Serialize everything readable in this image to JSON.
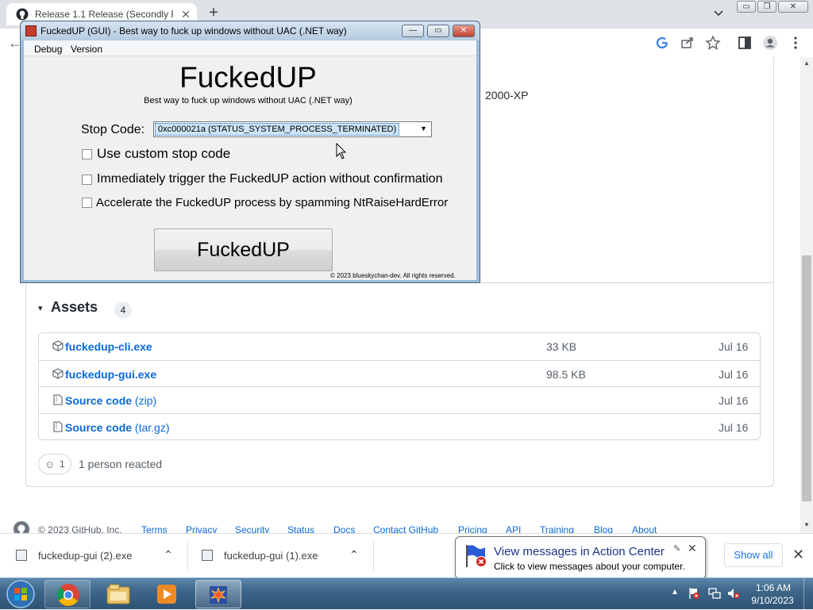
{
  "browser": {
    "tab_title": "Release 1.1 Release (Secondly Re",
    "tab_close": "✕",
    "new_tab": "+",
    "back": "←"
  },
  "window_controls": {
    "minimize": "▭",
    "restore": "❐",
    "close": "✕"
  },
  "page": {
    "platform_text": "2000-XP",
    "assets": {
      "title": "Assets",
      "caret": "▾",
      "count": "4",
      "items": [
        {
          "name": "fuckedup-cli.exe",
          "suffix": "",
          "size": "33 KB",
          "date": "Jul 16"
        },
        {
          "name": "fuckedup-gui.exe",
          "suffix": "",
          "size": "98.5 KB",
          "date": "Jul 16"
        },
        {
          "name": "Source code",
          "suffix": " (zip)",
          "size": "",
          "date": "Jul 16"
        },
        {
          "name": "Source code",
          "suffix": " (tar.gz)",
          "size": "",
          "date": "Jul 16"
        }
      ]
    },
    "reaction": {
      "emoji": "☺",
      "count": "1",
      "text": "1 person reacted"
    },
    "footer": {
      "copyright": "© 2023 GitHub, Inc.",
      "links": [
        "Terms",
        "Privacy",
        "Security",
        "Status",
        "Docs",
        "Contact GitHub",
        "Pricing",
        "API",
        "Training",
        "Blog",
        "About"
      ]
    }
  },
  "app": {
    "title": "FuckedUP (GUI) - Best way to fuck up windows without UAC (.NET way)",
    "menu": [
      "Debug",
      "Version"
    ],
    "heading": "FuckedUP",
    "subtitle": "Best way to fuck up windows without UAC (.NET way)",
    "stop_code_label": "Stop Code:",
    "stop_code_value": "0xc000021a (STATUS_SYSTEM_PROCESS_TERMINATED)",
    "checkbox_custom": "Use custom stop code",
    "checkbox_immediate": "Immediately trigger the FuckedUP action without confirmation",
    "checkbox_accelerate": "Accelerate the FuckedUP process by spamming NtRaiseHardError",
    "button": "FuckedUP",
    "copyright": "© 2023 blueskychan-dev. All rights reserved.",
    "ctrl_min": "—",
    "ctrl_max": "▭",
    "ctrl_close": "✕",
    "checked": [
      false,
      false,
      false
    ]
  },
  "downloads": {
    "items": [
      "fuckedup-gui (2).exe",
      "fuckedup-gui (1).exe"
    ],
    "chevron": "⌃",
    "show_all": "Show all",
    "close": "✕"
  },
  "balloon": {
    "title": "View messages in Action Center",
    "text": "Click to view messages about your computer.",
    "close": "✕",
    "pin": "✎"
  },
  "taskbar": {
    "tray_up": "▲",
    "time": "1:06 AM",
    "date": "9/10/2023"
  },
  "colors": {
    "link": "#0969da",
    "taskbar": "#3d6689",
    "window_frame": "#9dbbd9",
    "selection": "#cce4f7"
  },
  "icons": [
    "github-icon",
    "chrome-icon",
    "explorer-icon",
    "media-player-icon",
    "fuckedup-app-icon",
    "action-center-flag-icon",
    "network-icon",
    "volume-muted-icon",
    "package-icon",
    "file-zip-icon"
  ]
}
